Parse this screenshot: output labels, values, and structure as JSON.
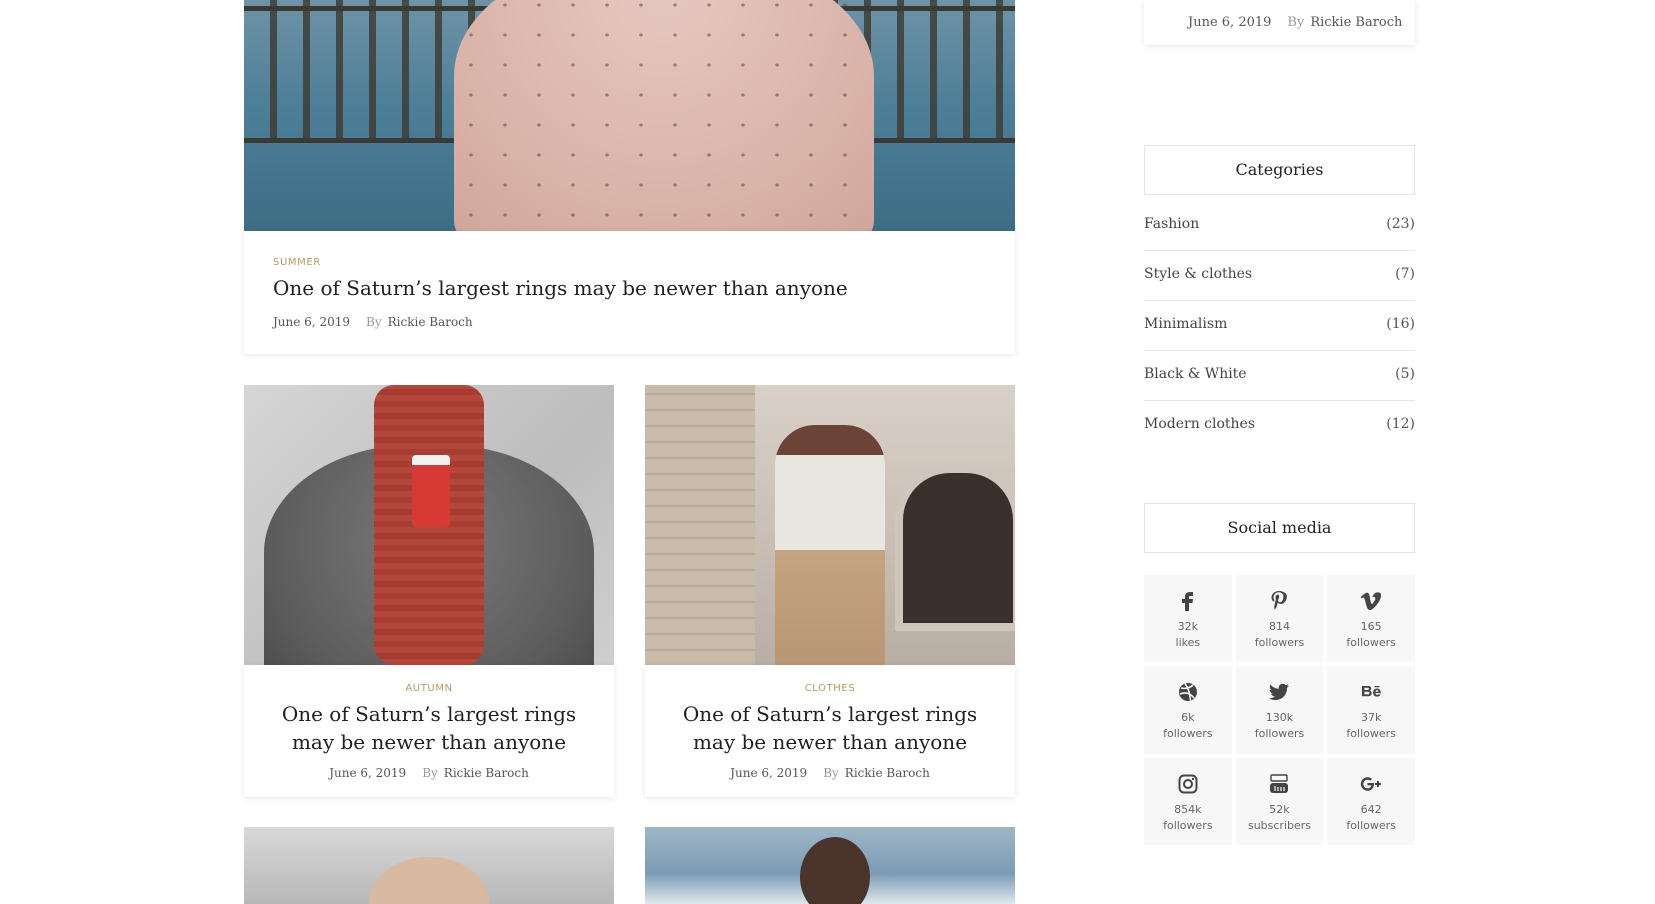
{
  "feature_post": {
    "category": "SUMMER",
    "title": "One of Saturn’s largest rings may be newer than anyone",
    "date": "June 6, 2019",
    "by_label": "By",
    "author": "Rickie Baroch"
  },
  "posts": [
    {
      "category": "AUTUMN",
      "title_line1": "One of Saturn’s largest rings",
      "title_line2": "may be newer than anyone",
      "date": "June 6, 2019",
      "by_label": "By",
      "author": "Rickie Baroch"
    },
    {
      "category": "CLOTHES",
      "title_line1": "One of Saturn’s largest rings",
      "title_line2": "may be newer than anyone",
      "date": "June 6, 2019",
      "by_label": "By",
      "author": "Rickie Baroch"
    }
  ],
  "sidebar": {
    "top_post": {
      "date": "June 6, 2019",
      "by_label": "By",
      "author": "Rickie Baroch"
    },
    "categories": {
      "title": "Categories",
      "items": [
        {
          "name": "Fashion",
          "count": "(23)"
        },
        {
          "name": "Style & clothes",
          "count": "(7)"
        },
        {
          "name": "Minimalism",
          "count": "(16)"
        },
        {
          "name": "Black & White",
          "count": "(5)"
        },
        {
          "name": "Modern clothes",
          "count": "(12)"
        }
      ]
    },
    "social": {
      "title": "Social media",
      "items": [
        {
          "icon": "facebook-icon",
          "count": "32k",
          "label": "likes"
        },
        {
          "icon": "pinterest-icon",
          "count": "814",
          "label": "followers"
        },
        {
          "icon": "vimeo-icon",
          "count": "165",
          "label": "followers"
        },
        {
          "icon": "dribbble-icon",
          "count": "6k",
          "label": "followers"
        },
        {
          "icon": "twitter-icon",
          "count": "130k",
          "label": "followers"
        },
        {
          "icon": "behance-icon",
          "count": "37k",
          "label": "followers"
        },
        {
          "icon": "instagram-icon",
          "count": "854k",
          "label": "followers"
        },
        {
          "icon": "youtube-icon",
          "count": "52k",
          "label": "subscribers"
        },
        {
          "icon": "google-plus-icon",
          "count": "642",
          "label": "followers"
        }
      ]
    }
  },
  "colors": {
    "accent": "#b49a62",
    "text": "#222222",
    "muted": "#999999"
  }
}
